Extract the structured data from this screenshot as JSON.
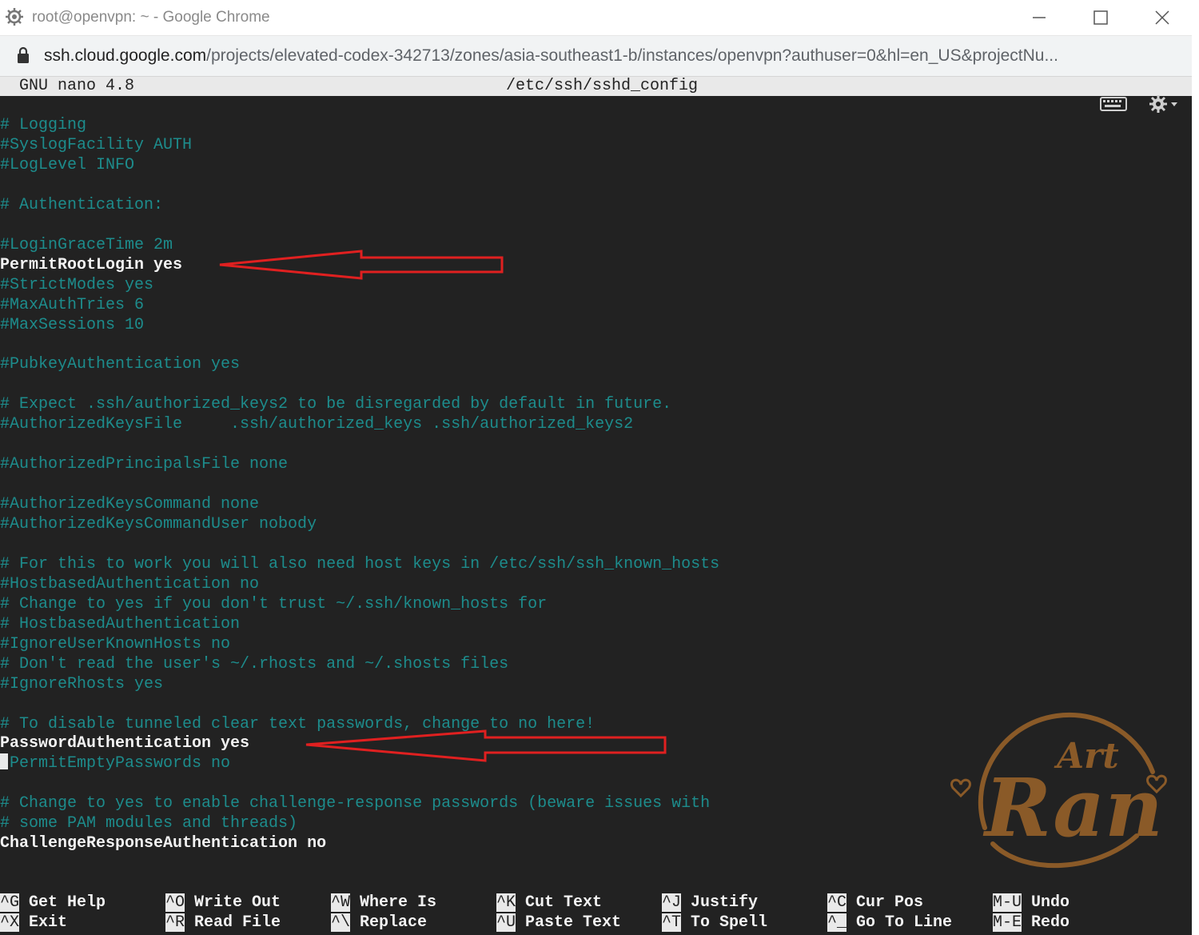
{
  "window": {
    "title": "root@openvpn: ~ - Google Chrome",
    "url_host": "ssh.cloud.google.com",
    "url_path": "/projects/elevated-codex-342713/zones/asia-southeast1-b/instances/openvpn?authuser=0&hl=en_US&projectNu..."
  },
  "nano": {
    "version": "GNU nano 4.8",
    "filename": "/etc/ssh/sshd_config"
  },
  "lines": [
    {
      "text": "# Logging",
      "style": "comment"
    },
    {
      "text": "#SyslogFacility AUTH",
      "style": "comment"
    },
    {
      "text": "#LogLevel INFO",
      "style": "comment"
    },
    {
      "text": "",
      "style": "comment"
    },
    {
      "text": "# Authentication:",
      "style": "comment"
    },
    {
      "text": "",
      "style": "comment"
    },
    {
      "text": "#LoginGraceTime 2m",
      "style": "comment"
    },
    {
      "text": "PermitRootLogin yes",
      "style": "setting"
    },
    {
      "text": "#StrictModes yes",
      "style": "comment"
    },
    {
      "text": "#MaxAuthTries 6",
      "style": "comment"
    },
    {
      "text": "#MaxSessions 10",
      "style": "comment"
    },
    {
      "text": "",
      "style": "comment"
    },
    {
      "text": "#PubkeyAuthentication yes",
      "style": "comment"
    },
    {
      "text": "",
      "style": "comment"
    },
    {
      "text": "# Expect .ssh/authorized_keys2 to be disregarded by default in future.",
      "style": "comment"
    },
    {
      "text": "#AuthorizedKeysFile     .ssh/authorized_keys .ssh/authorized_keys2",
      "style": "comment"
    },
    {
      "text": "",
      "style": "comment"
    },
    {
      "text": "#AuthorizedPrincipalsFile none",
      "style": "comment"
    },
    {
      "text": "",
      "style": "comment"
    },
    {
      "text": "#AuthorizedKeysCommand none",
      "style": "comment"
    },
    {
      "text": "#AuthorizedKeysCommandUser nobody",
      "style": "comment"
    },
    {
      "text": "",
      "style": "comment"
    },
    {
      "text": "# For this to work you will also need host keys in /etc/ssh/ssh_known_hosts",
      "style": "comment"
    },
    {
      "text": "#HostbasedAuthentication no",
      "style": "comment"
    },
    {
      "text": "# Change to yes if you don't trust ~/.ssh/known_hosts for",
      "style": "comment"
    },
    {
      "text": "# HostbasedAuthentication",
      "style": "comment"
    },
    {
      "text": "#IgnoreUserKnownHosts no",
      "style": "comment"
    },
    {
      "text": "# Don't read the user's ~/.rhosts and ~/.shosts files",
      "style": "comment"
    },
    {
      "text": "#IgnoreRhosts yes",
      "style": "comment"
    },
    {
      "text": "",
      "style": "comment"
    },
    {
      "text": "# To disable tunneled clear text passwords, change to no here!",
      "style": "comment"
    },
    {
      "text": "PasswordAuthentication yes",
      "style": "setting"
    },
    {
      "text": "PermitEmptyPasswords no",
      "style": "cursorline"
    },
    {
      "text": "",
      "style": "comment"
    },
    {
      "text": "# Change to yes to enable challenge-response passwords (beware issues with",
      "style": "comment"
    },
    {
      "text": "# some PAM modules and threads)",
      "style": "comment"
    },
    {
      "text": "ChallengeResponseAuthentication no",
      "style": "setting"
    }
  ],
  "shortcuts": [
    {
      "key1": "^G",
      "label1": "Get Help",
      "key2": "^X",
      "label2": "Exit"
    },
    {
      "key1": "^O",
      "label1": "Write Out",
      "key2": "^R",
      "label2": "Read File"
    },
    {
      "key1": "^W",
      "label1": "Where Is",
      "key2": "^\\",
      "label2": "Replace"
    },
    {
      "key1": "^K",
      "label1": "Cut Text",
      "key2": "^U",
      "label2": "Paste Text"
    },
    {
      "key1": "^J",
      "label1": "Justify",
      "key2": "^T",
      "label2": "To Spell"
    },
    {
      "key1": "^C",
      "label1": "Cur Pos",
      "key2": "^_",
      "label2": "Go To Line"
    },
    {
      "key1": "M-U",
      "label1": "Undo",
      "key2": "M-E",
      "label2": "Redo"
    }
  ],
  "watermark": {
    "line1": "Art",
    "line2": "Ran"
  },
  "colors": {
    "terminal_bg": "#222222",
    "comment": "#1d8c8c",
    "setting": "#f2f2f2",
    "annotation_arrow": "#e02020",
    "watermark": "#8a5a28"
  },
  "icons": {
    "app": "chrome-tab-icon",
    "lock": "lock-icon",
    "keyboard": "keyboard-icon",
    "settings": "gear-icon"
  }
}
